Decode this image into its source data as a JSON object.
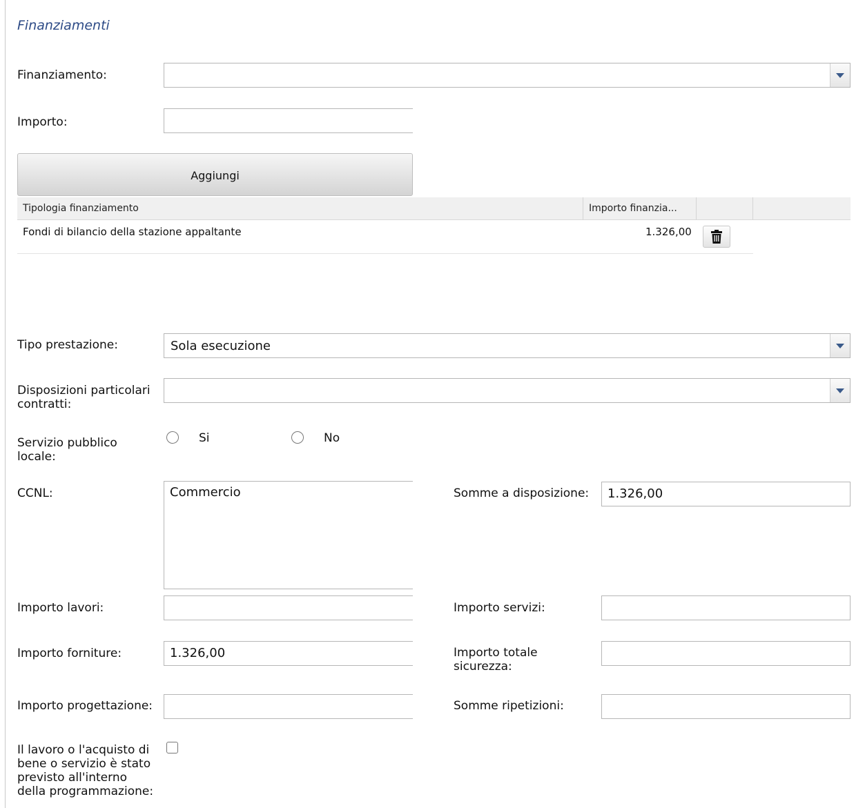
{
  "section": {
    "title": "Finanziamenti"
  },
  "finanziamento": {
    "label": "Finanziamento:",
    "value": ""
  },
  "importo": {
    "label": "Importo:",
    "value": ""
  },
  "aggiungi": {
    "label": "Aggiungi"
  },
  "grid": {
    "headers": [
      "Tipologia finanziamento",
      "Importo finanzia...",
      "",
      ""
    ],
    "rows": [
      {
        "tipologia": "Fondi di bilancio della stazione appaltante",
        "importo": "1.326,00",
        "action_icon": "trash-icon"
      }
    ]
  },
  "tipo_prestazione": {
    "label": "Tipo prestazione:",
    "value": "Sola esecuzione"
  },
  "disposizioni": {
    "label_line1": "Disposizioni particolari",
    "label_line2": "contratti:",
    "value": ""
  },
  "servizio_pubblico": {
    "label_line1": "Servizio pubblico",
    "label_line2": "locale:",
    "options": [
      "Si",
      "No"
    ],
    "selected": null
  },
  "ccnl": {
    "label": "CCNL:",
    "value": "Commercio"
  },
  "somme_disposizione": {
    "label": "Somme a disposizione:",
    "value": "1.326,00"
  },
  "importo_lavori": {
    "label": "Importo lavori:",
    "value": ""
  },
  "importo_servizi": {
    "label": "Importo servizi:",
    "value": ""
  },
  "importo_forniture": {
    "label": "Importo forniture:",
    "value": "1.326,00"
  },
  "importo_sicurezza": {
    "label_line1": "Importo totale",
    "label_line2": "sicurezza:",
    "value": ""
  },
  "importo_progettazione": {
    "label": "Importo progettazione:",
    "value": ""
  },
  "somme_ripetizioni": {
    "label": "Somme ripetizioni:",
    "value": ""
  },
  "programmazione": {
    "label_lines": [
      "Il lavoro o l'acquisto di",
      "bene o servizio è stato",
      "previsto all'interno",
      "della programmazione:"
    ],
    "checked": false
  },
  "colors": {
    "title": "#2c4a86",
    "chevron": "#3a5a8a",
    "border": "#b6b6b6"
  }
}
